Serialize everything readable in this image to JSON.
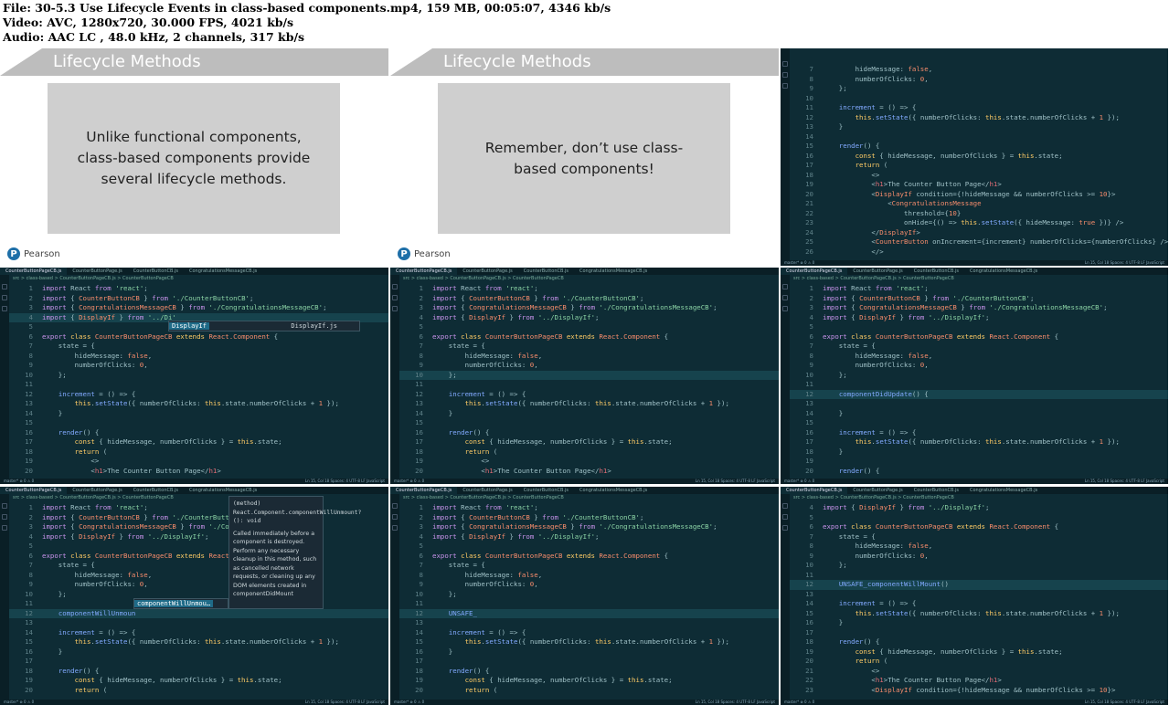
{
  "header": {
    "line1": "File: 30-5.3 Use Lifecycle Events in class-based components.mp4, 159 MB, 00:05:07, 4346 kb/s",
    "line2": "Video: AVC, 1280x720, 30.000 FPS, 4021 kb/s",
    "line3": "Audio: AAC LC , 48.0 kHz, 2 channels, 317 kb/s"
  },
  "slides": [
    {
      "title": "Lifecycle Methods",
      "body": "Unlike functional components, class-based components provide several lifecycle methods.",
      "logo": "Pearson"
    },
    {
      "title": "Lifecycle Methods",
      "body": "Remember, don’t use class-based components!",
      "logo": "Pearson"
    }
  ],
  "editor": {
    "tabs": [
      "CounterButtonPageCB.js",
      "CounterButtonPage.js",
      "CounterButtonCB.js",
      "CongratulationsMessageCB.js"
    ],
    "crumb": "src > class-based > CounterButtonPageCB.js > CounterButtonPageCB",
    "status_left": "master* ⊗ 0 ⚠ 0",
    "status_right": "Ln 15, Col 18   Spaces: 4   UTF-8   LF   JavaScript",
    "popups": {
      "suggest_a": "DisplayIf",
      "suggest_a_detail": "DisplayIf.js",
      "suggest_b": "componentWillUnmou…",
      "doc_sig": "(method) React.Component.componentWillUnmount?(): void",
      "doc_text": "Called immediately before a component is destroyed. Perform any necessary cleanup in this method, such as cancelled network requests, or cleaning up any DOM elements created in componentDidMount"
    }
  }
}
